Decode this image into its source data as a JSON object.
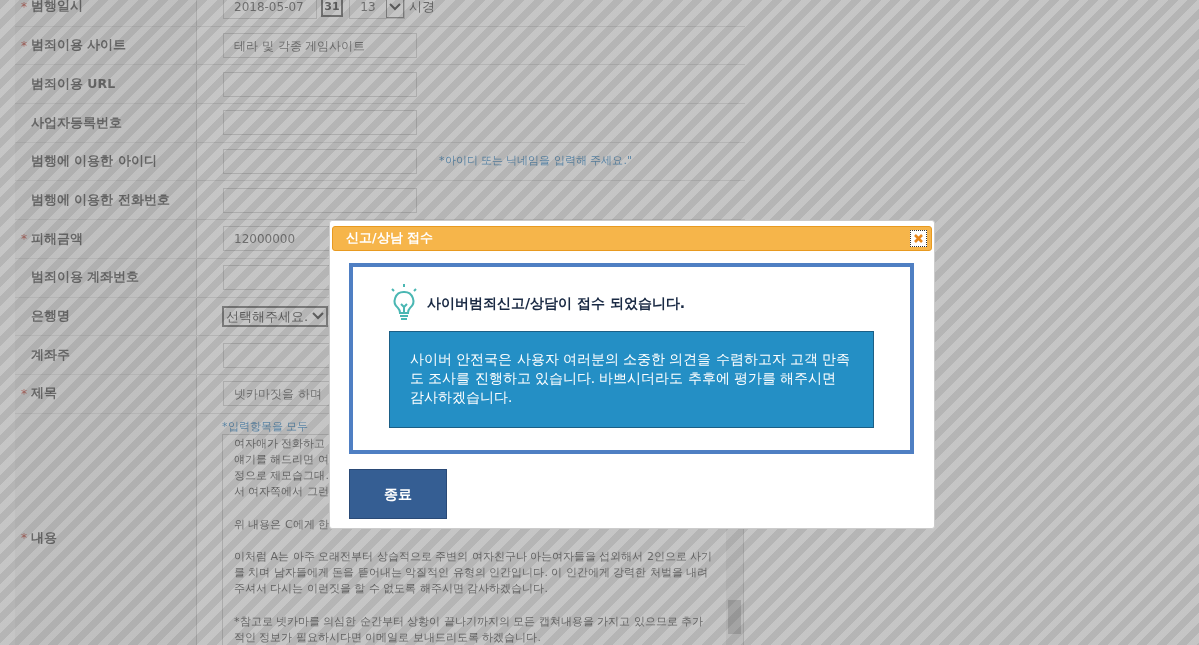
{
  "form": {
    "rows": [
      {
        "kind": "datetime",
        "mark": "*",
        "label": "범행일시",
        "date": "2018-05-07",
        "calendar": "31",
        "hour": "13",
        "suffix": "시경"
      },
      {
        "kind": "text",
        "mark": "*",
        "label": "범죄이용 사이트",
        "value": "테라 및 각종 게임사이트"
      },
      {
        "kind": "text",
        "label": "범죄이용 URL",
        "value": ""
      },
      {
        "kind": "text",
        "label": "사업자등록번호",
        "value": ""
      },
      {
        "kind": "text",
        "label": "범행에 이용한 아이디",
        "value": "",
        "hint": "*아이디 또는 닉네임을 입력해 주세요.\""
      },
      {
        "kind": "text",
        "label": "범행에 이용한 전화번호",
        "value": ""
      },
      {
        "kind": "text",
        "mark": "*",
        "label": "피해금액",
        "value": "12000000"
      },
      {
        "kind": "text",
        "label": "범죄이용 계좌번호",
        "value": ""
      },
      {
        "kind": "select",
        "label": "은행명",
        "value": "선택해주세요."
      },
      {
        "kind": "text",
        "label": "계좌주",
        "value": ""
      },
      {
        "kind": "text",
        "mark": "*",
        "label": "제목",
        "value": "넷카마짓을 하며"
      },
      {
        "kind": "textarea",
        "mark": "*",
        "label": "내용",
        "hint": "*입력항목을 모두",
        "paragraphs": [
          [
            "여자애가 전화하고",
            "얘기를 해드리면 여",
            "정으로 제모습그대.",
            "서 여자쪽에서 그런"
          ],
          [
            "위 내용은 C에게 한"
          ],
          [
            "이처럼 A는 아주 오래전부터 상습적으로 주변의 여자친구나 아는여자들을 섭외해서 2인으로 사기",
            "를 치며 남자들에게 돈을 뜯어내는 악질적인 유형의 인간입니다. 이 인간에게 강력한 처벌을 내려",
            "주셔서 다시는 이런짓을 할 수 없도록 해주시면 감사하겠습니다."
          ],
          [
            "*참고로 넷카마를 의심한 순간부터 상황이 끝나기까지의 모든 캡쳐내용을 가지고 있으므로 추가",
            "적인 정보가 필요하시다면 이메일로 보내드리도록 하겠습니다."
          ]
        ]
      }
    ]
  },
  "dialog": {
    "title": "신고/상남 접수",
    "heading": "사이버범죄신고/상담이 접수 되었습니다.",
    "message": "사이버 안전국은 사용자 여러분의 소중한 의견을 수렴하고자 고객 만족도 조사를 진행하고 있습니다. 바쁘시더라도 추후에 평가를 해주시면 감사하겠습니다.",
    "button": "종료"
  }
}
